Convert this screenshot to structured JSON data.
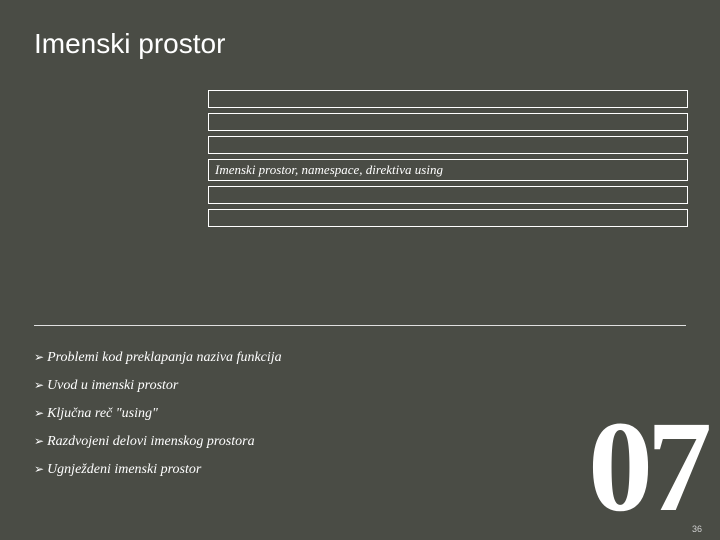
{
  "title": "Imenski prostor",
  "subtitle": "Imenski prostor, namespace, direktiva using",
  "bullets": [
    "Problemi kod preklapanja naziva funkcija",
    "Uvod u imenski prostor",
    "Ključna reč \"using\"",
    "Razdvojeni delovi imenskog prostora",
    "Ugnježdeni imenski prostor"
  ],
  "big_number": "07",
  "page_number": "36"
}
